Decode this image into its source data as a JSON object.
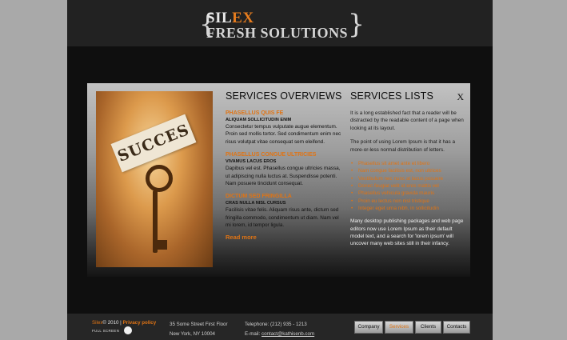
{
  "logo": {
    "brace_left": "{",
    "brand_part1": "SIL",
    "brand_part2": "EX",
    "tagline": "FRESH SOLUTIONS",
    "brace_right": "}"
  },
  "panel": {
    "photo_note_text": "SUCCES",
    "overview": {
      "heading": "SERVICES OVERVIEWS",
      "items": [
        {
          "title": "PHASELLUS QUIS FE",
          "subtitle": "ALIQUAM SOLLICITUDIN ENIM",
          "body": "Consectetur tempus vulputate augue elementum. Proin sed mollis tortor. Sed condimentum enim nec risus volutpat vitae consequat sem eleifend."
        },
        {
          "title": "PHASELLUS CONGUE ULTRICIES",
          "subtitle": "VIVAMUS LACUS EROS",
          "body": "Dapibus vel est. Phasellus congue ultricies massa, ut adipiscing nulla luctus at. Suspendisse potenti. Nam posuere tincidunt consequat."
        },
        {
          "title": "DICTUM SED FRINGILLA",
          "subtitle": "CRAS NULLA NISL CURSUS",
          "body": "Facilisis vitae felis. Aliquam risus ante, dictum sed fringilla commodo, condimentum ut diam. Nam vel mi lorem, id tempor ligula."
        }
      ],
      "read_more": "Read more"
    },
    "lists": {
      "heading": "SERVICES LISTS",
      "close_label": "X",
      "para1": "It is a long established fact that a reader will be distracted by the readable content of a page when looking at its layout.",
      "para2": "The point of using Lorem Ipsum is that it has a more-or-less normal distribution of letters.",
      "bullets": [
        "Phasellus sit amet ante et libero",
        "Nam congue facilisis est, non ultrices",
        "Vestibulum nec nunc at lacus posuere",
        "Donec feugiat velit id eros mattis vel",
        "Phasellus vehicula gravida mauris",
        "Proin eu lectus non nisl tristique",
        "Integer eget urna nibh, in sollicitudin"
      ],
      "para3": "Many desktop publishing packages and web page editors now use Lorem Ipsum as their default model text, and a search for 'lorem ipsum' will uncover many web sites still in their infancy."
    }
  },
  "footer": {
    "brand": "Silex",
    "copyright": "© 2010 |",
    "privacy": "Privacy policy",
    "fullscreen": "FULL SCREEN",
    "address_line1": "35 Some Street First Floor",
    "address_line2": "New York, NY 10004",
    "telephone": "Telephone: (212) 935 - 1213",
    "email_label": "E-mail:",
    "email": "contact@kathisenb.com",
    "nav": [
      {
        "label": "Company",
        "active": false
      },
      {
        "label": "Services",
        "active": true
      },
      {
        "label": "Clients",
        "active": false
      },
      {
        "label": "Contacts",
        "active": false
      }
    ]
  }
}
